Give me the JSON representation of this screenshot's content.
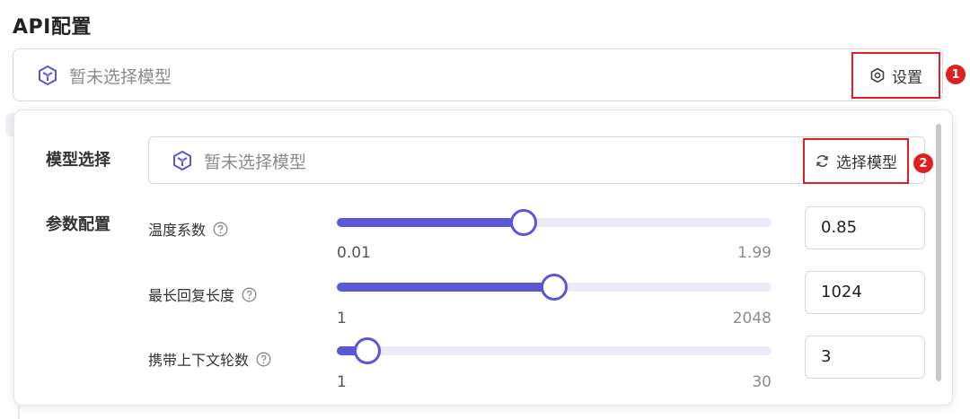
{
  "page_title": "API配置",
  "top_select": {
    "icon": "model-logo-icon",
    "placeholder": "暂未选择模型",
    "settings_label": "设置",
    "settings_icon": "gear-icon"
  },
  "markers": [
    "1",
    "2"
  ],
  "panel": {
    "model_section_label": "模型选择",
    "model_select": {
      "icon": "model-logo-icon",
      "placeholder": "暂未选择模型",
      "choose_label": "选择模型",
      "choose_icon": "refresh-icon"
    },
    "params_section_label": "参数配置",
    "params": [
      {
        "label": "温度系数",
        "min": "0.01",
        "max": "1.99",
        "value": "0.85",
        "fraction": 0.43
      },
      {
        "label": "最长回复长度",
        "min": "1",
        "max": "2048",
        "value": "1024",
        "fraction": 0.5
      },
      {
        "label": "携带上下文轮数",
        "min": "1",
        "max": "30",
        "value": "3",
        "fraction": 0.07
      }
    ]
  },
  "colors": {
    "accent": "#5b57d6",
    "track": "#ebebfa",
    "highlight_border": "#e02020"
  }
}
